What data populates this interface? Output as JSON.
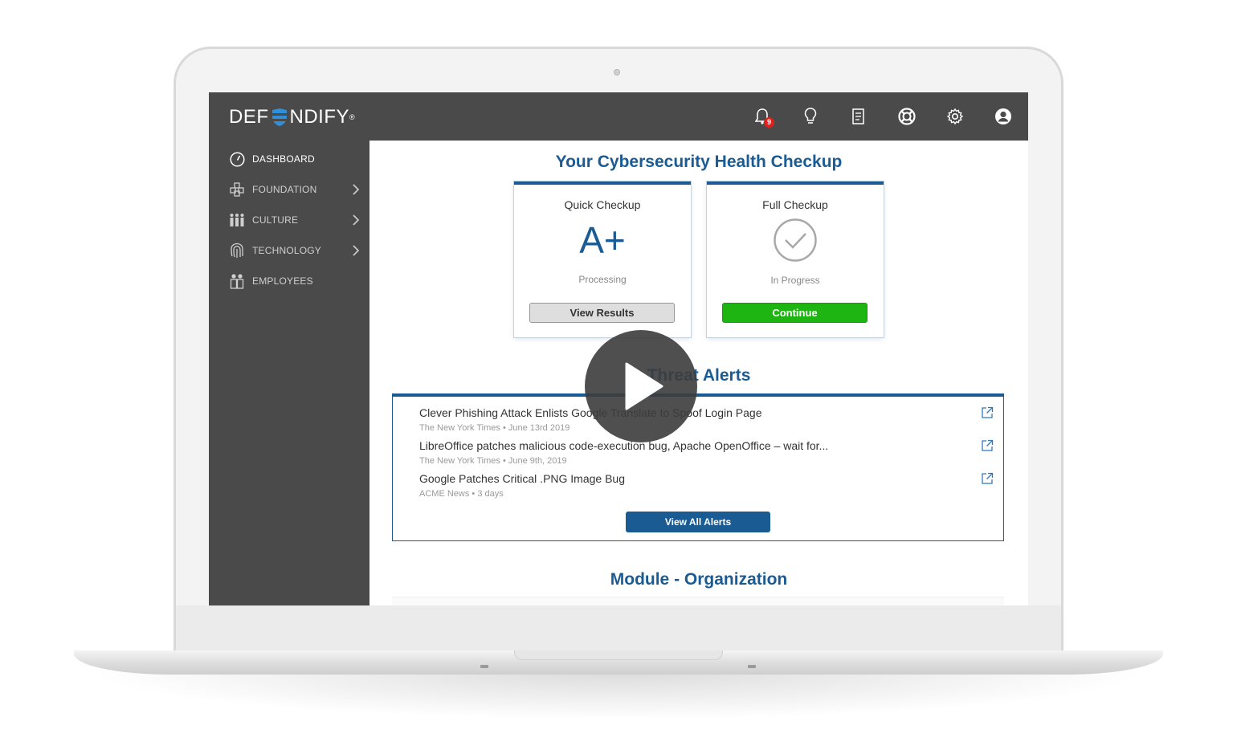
{
  "app": {
    "logo_left": "DEF",
    "logo_right": "NDIFY",
    "logo_tm": "®",
    "notification_count": "9"
  },
  "topbar": {
    "icons": [
      "bell-icon",
      "lightbulb-icon",
      "document-icon",
      "lifebuoy-icon",
      "gear-icon",
      "user-icon"
    ]
  },
  "sidebar": {
    "items": [
      {
        "label": "DASHBOARD",
        "icon": "gauge-icon",
        "has_chevron": false
      },
      {
        "label": "FOUNDATION",
        "icon": "cubes-icon",
        "has_chevron": true
      },
      {
        "label": "CULTURE",
        "icon": "people-icon",
        "has_chevron": true
      },
      {
        "label": "TECHNOLOGY",
        "icon": "fingerprint-icon",
        "has_chevron": true
      },
      {
        "label": "EMPLOYEES",
        "icon": "employees-icon",
        "has_chevron": false
      }
    ]
  },
  "health": {
    "title": "Your Cybersecurity Health Checkup",
    "quick": {
      "title": "Quick Checkup",
      "grade": "A+",
      "status": "Processing",
      "button": "View Results"
    },
    "full": {
      "title": "Full Checkup",
      "status": "In Progress",
      "button": "Continue"
    }
  },
  "alerts": {
    "title": "Threat Alerts",
    "items": [
      {
        "title": "Clever Phishing Attack Enlists Google Translate to Spoof Login Page",
        "source": "The New York Times",
        "date": "June 13rd 2019"
      },
      {
        "title": "LibreOffice patches malicious code-execution bug, Apache OpenOffice – wait for...",
        "source": "The New York Times",
        "date": "June 9th, 2019"
      },
      {
        "title": "Google Patches Critical .PNG Image Bug",
        "source": "ACME News",
        "date": "3 days"
      }
    ],
    "button": "View All Alerts"
  },
  "module": {
    "title": "Module - Organization"
  },
  "colors": {
    "accent": "#1a5b94",
    "topbar": "#4a4a4a",
    "success": "#1eb512",
    "badge": "#e0201c"
  }
}
